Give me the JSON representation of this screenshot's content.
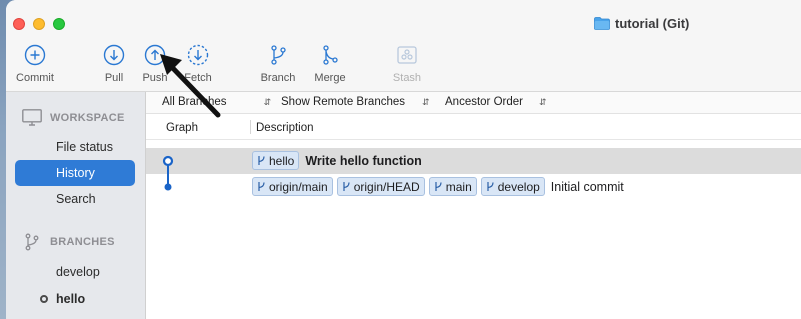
{
  "window": {
    "title": "tutorial (Git)"
  },
  "toolbar": {
    "commit": {
      "label": "Commit",
      "icon": "plus-circle-icon"
    },
    "pull": {
      "label": "Pull",
      "icon": "arrow-down-circle-icon"
    },
    "push": {
      "label": "Push",
      "icon": "arrow-up-circle-icon"
    },
    "fetch": {
      "label": "Fetch",
      "icon": "dashed-arrow-down-circle-icon"
    },
    "branch": {
      "label": "Branch",
      "icon": "branch-icon"
    },
    "merge": {
      "label": "Merge",
      "icon": "merge-icon"
    },
    "stash": {
      "label": "Stash",
      "icon": "stash-icon"
    }
  },
  "sidebar": {
    "workspace_header": "WORKSPACE",
    "workspace_items": [
      {
        "label": "File status"
      },
      {
        "label": "History"
      },
      {
        "label": "Search"
      }
    ],
    "branches_header": "BRANCHES",
    "branches": [
      {
        "label": "develop"
      },
      {
        "label": "hello"
      }
    ]
  },
  "filters": {
    "branches": "All Branches",
    "remote": "Show Remote Branches",
    "order": "Ancestor Order"
  },
  "columns": {
    "graph": "Graph",
    "description": "Description"
  },
  "commits": [
    {
      "tags": [
        "hello"
      ],
      "message": "Write hello function"
    },
    {
      "tags": [
        "origin/main",
        "origin/HEAD",
        "main",
        "develop"
      ],
      "message": "Initial commit"
    }
  ],
  "colors": {
    "accent": "#2f7bd6",
    "graph": "#1a64c8",
    "tag_bg": "#d9e6f6"
  }
}
